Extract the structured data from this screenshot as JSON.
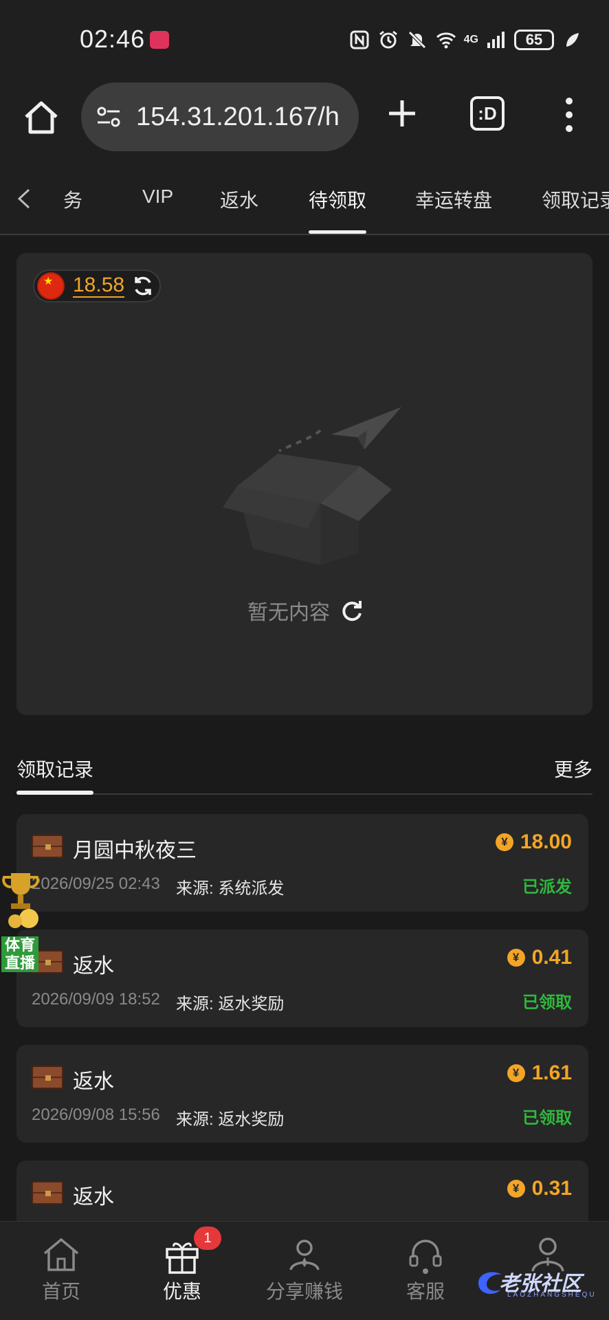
{
  "status_bar": {
    "time": "02:46",
    "network": "4G",
    "battery": "65"
  },
  "browser": {
    "url": "154.31.201.167/h",
    "tabs_label": ":D"
  },
  "tabs": [
    {
      "label": "务"
    },
    {
      "label": "VIP"
    },
    {
      "label": "返水"
    },
    {
      "label": "待领取"
    },
    {
      "label": "幸运转盘"
    },
    {
      "label": "领取记录"
    }
  ],
  "balance": {
    "value": "18.58"
  },
  "empty_state": {
    "text": "暂无内容"
  },
  "records": {
    "title": "领取记录",
    "more": "更多",
    "items": [
      {
        "title": "月圆中秋夜三",
        "amount": "18.00",
        "date": "2026/09/25 02:43",
        "source": "来源: 系统派发",
        "status": "已派发"
      },
      {
        "title": "返水",
        "amount": "0.41",
        "date": "2026/09/09 18:52",
        "source": "来源: 返水奖励",
        "status": "已领取"
      },
      {
        "title": "返水",
        "amount": "1.61",
        "date": "2026/09/08 15:56",
        "source": "来源: 返水奖励",
        "status": "已领取"
      },
      {
        "title": "返水",
        "amount": "0.31",
        "date": "",
        "source": "",
        "status": ""
      }
    ]
  },
  "float_widget": {
    "line1": "体育",
    "line2": "直播"
  },
  "bottom_nav": {
    "items": [
      {
        "label": "首页"
      },
      {
        "label": "优惠"
      },
      {
        "label": "分享赚钱"
      },
      {
        "label": "客服"
      }
    ],
    "badge": "1"
  },
  "watermark": {
    "text": "老张社区",
    "sub": "LAOZHANGSHEQU"
  },
  "colors": {
    "accent": "#f3a526",
    "success": "#2fb83d",
    "badge": "#e5383b",
    "background": "#1a1a1a"
  }
}
